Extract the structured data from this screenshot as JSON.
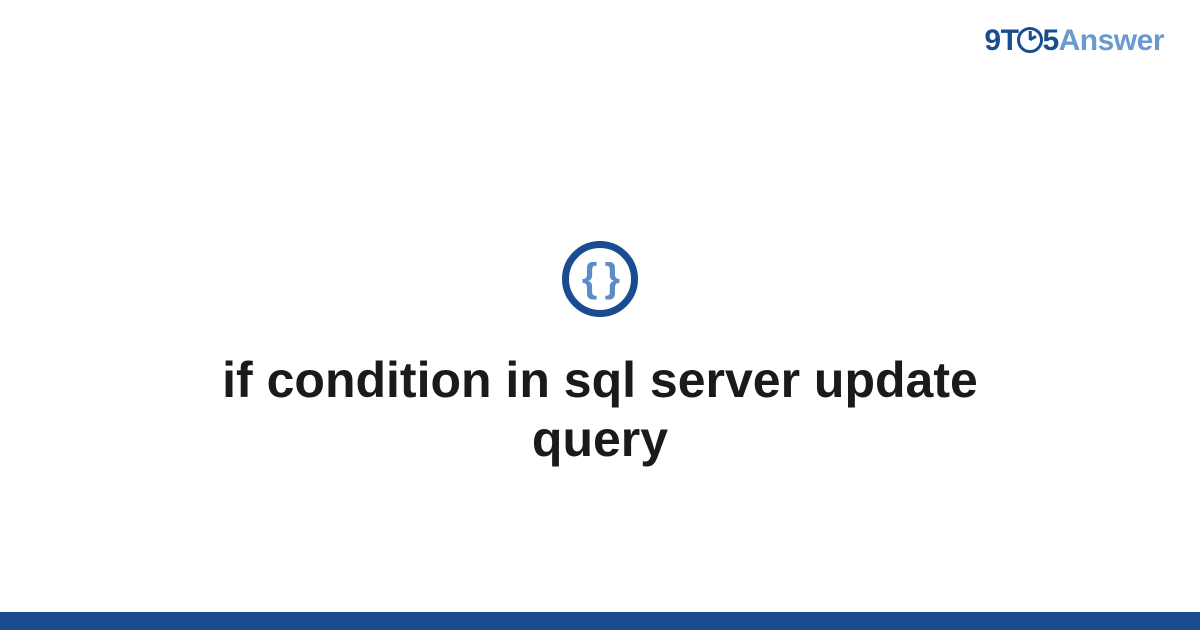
{
  "brand": {
    "part_nine": "9",
    "part_t": "T",
    "part_five": "5",
    "part_answer": "Answer",
    "clock_icon_name": "clock-icon"
  },
  "category_icon": {
    "braces_glyph": "{ }",
    "name": "code-braces-icon"
  },
  "page": {
    "title": "if condition in sql server update query"
  },
  "colors": {
    "brand_dark": "#1a4d8f",
    "brand_light": "#6a99d0",
    "braces": "#5a8cc7",
    "text": "#1a1a1a",
    "background": "#ffffff"
  }
}
